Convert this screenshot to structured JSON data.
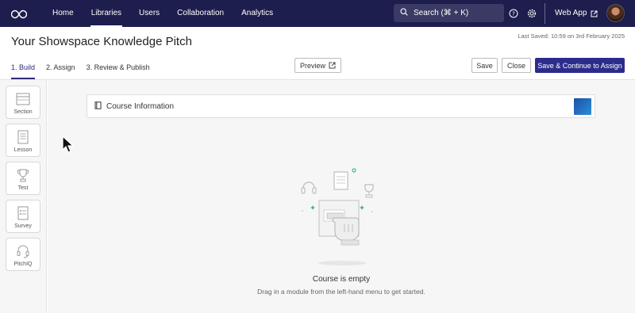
{
  "nav": {
    "items": [
      {
        "label": "Home"
      },
      {
        "label": "Libraries",
        "active": true
      },
      {
        "label": "Users"
      },
      {
        "label": "Collaboration"
      },
      {
        "label": "Analytics"
      }
    ],
    "search_label": "Search (⌘ + K)",
    "webapp_label": "Web App",
    "icons": [
      "logo-icon",
      "search-icon",
      "help-icon",
      "settings-icon",
      "external-link-icon",
      "avatar"
    ],
    "bg_color": "#1d1d4e"
  },
  "header": {
    "title": "Your Showspace Knowledge Pitch",
    "last_saved": "Last Saved: 10:59 on 3rd February 2025"
  },
  "steps": [
    {
      "label": "1. Build",
      "active": true
    },
    {
      "label": "2. Assign"
    },
    {
      "label": "3. Review & Publish"
    }
  ],
  "toolbar": {
    "preview_label": "Preview",
    "save_label": "Save",
    "close_label": "Close",
    "save_continue_label": "Save & Continue to Assign",
    "primary_color": "#2c2c8c"
  },
  "modules": [
    {
      "label": "Section",
      "icon": "section-icon"
    },
    {
      "label": "Lesson",
      "icon": "lesson-icon"
    },
    {
      "label": "Test",
      "icon": "trophy-icon"
    },
    {
      "label": "Survey",
      "icon": "survey-icon"
    },
    {
      "label": "PitchIQ",
      "icon": "headset-icon"
    }
  ],
  "course": {
    "title": "Course Information"
  },
  "empty_state": {
    "title": "Course is empty",
    "subtitle": "Drag in a module from the left-hand menu to get started."
  }
}
